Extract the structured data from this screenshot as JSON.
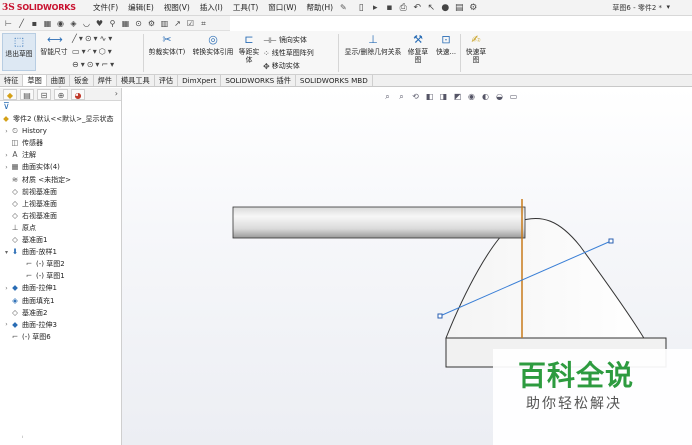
{
  "app": {
    "logo_ds": "3S",
    "logo_text": "SOLIDWORKS"
  },
  "menu": [
    "文件(F)",
    "编辑(E)",
    "视图(V)",
    "插入(I)",
    "工具(T)",
    "窗口(W)",
    "帮助(H)"
  ],
  "document_title": "草图6 - 零件2 *",
  "ribbon": {
    "exit_sketch": "退出草图",
    "smart_dimension": "智能尺寸",
    "trim_entities": "剪裁实体(T)",
    "convert_entities": "转换实体引用",
    "offset_entities": "等距实体",
    "mirror_entities": "镜向实体",
    "linear_pattern": "线性草图阵列",
    "move_entities": "移动实体",
    "display_relations": "显示/删除几何关系",
    "repair_sketch": "修复草图",
    "quick_snaps": "快速...",
    "rapid_sketch": "快速草图"
  },
  "tabs": [
    "特征",
    "草图",
    "曲面",
    "钣金",
    "焊件",
    "模具工具",
    "评估",
    "DimXpert",
    "SOLIDWORKS 插件",
    "SOLIDWORKS MBD"
  ],
  "active_tab": "草图",
  "tree": {
    "root": "零件2 (默认<<默认>_显示状态",
    "items": [
      {
        "label": "History",
        "icon": "history-icon",
        "caret": true
      },
      {
        "label": "传感器",
        "icon": "sensor-icon",
        "caret": false
      },
      {
        "label": "注解",
        "icon": "annotation-icon",
        "caret": true
      },
      {
        "label": "曲面实体(4)",
        "icon": "surface-bodies-icon",
        "caret": true
      },
      {
        "label": "材质 <未指定>",
        "icon": "material-icon",
        "caret": false
      },
      {
        "label": "前视基准面",
        "icon": "plane-icon",
        "caret": false
      },
      {
        "label": "上视基准面",
        "icon": "plane-icon",
        "caret": false
      },
      {
        "label": "右视基准面",
        "icon": "plane-icon",
        "caret": false
      },
      {
        "label": "原点",
        "icon": "origin-icon",
        "caret": false
      },
      {
        "label": "基准面1",
        "icon": "plane-icon",
        "caret": false
      },
      {
        "label": "曲面-放样1",
        "icon": "loft-icon",
        "caret": true,
        "expanded": true
      },
      {
        "label": "(-) 草图2",
        "icon": "sketch-icon",
        "caret": false,
        "indent": 1
      },
      {
        "label": "(-) 草图1",
        "icon": "sketch-icon",
        "caret": false,
        "indent": 1
      },
      {
        "label": "曲面-拉伸1",
        "icon": "extrude-icon",
        "caret": true
      },
      {
        "label": "曲面填充1",
        "icon": "fill-icon",
        "caret": false
      },
      {
        "label": "基准面2",
        "icon": "plane-icon",
        "caret": false
      },
      {
        "label": "曲面-拉伸3",
        "icon": "extrude-icon",
        "caret": true
      },
      {
        "label": "(-) 草图6",
        "icon": "sketch-icon",
        "caret": false
      }
    ]
  },
  "watermark": {
    "title": "百科全说",
    "subtitle": "助你轻松解决"
  },
  "colors": {
    "accent": "#2a6db5",
    "logo_red": "#c8102e",
    "sketch_line": "#3a7fd6",
    "vertical_line": "#c77a1a",
    "watermark_green": "#2d9b3f"
  }
}
